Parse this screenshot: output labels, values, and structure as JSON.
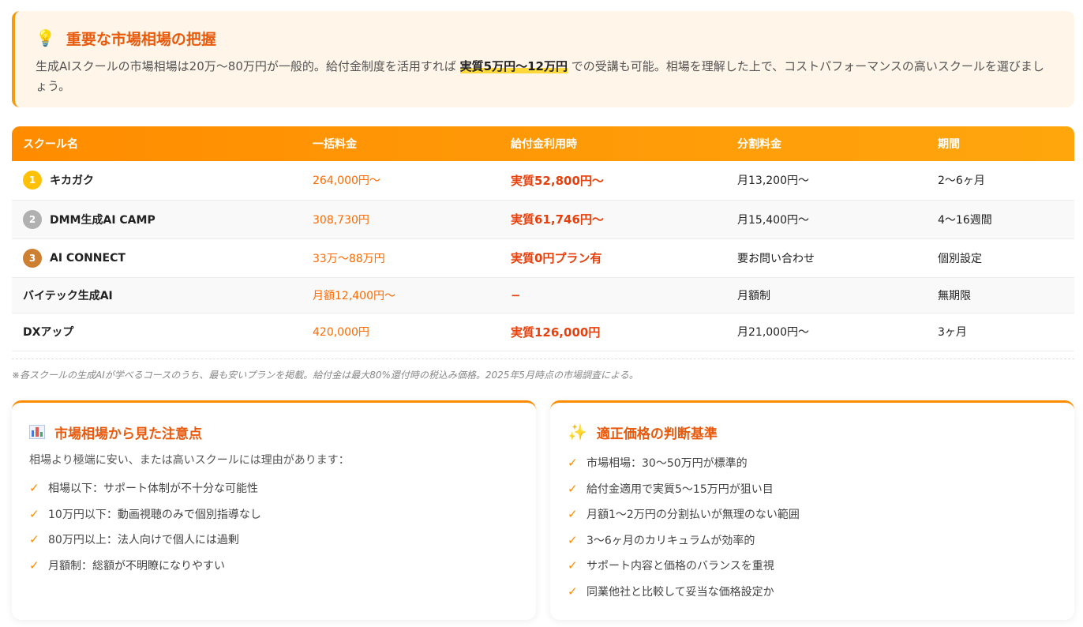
{
  "alert": {
    "icon": "lightbulb-icon",
    "title": "重要な市場相場の把握",
    "text_before": "生成AIスクールの市場相場は20万〜80万円が一般的。給付金制度を活用すれば ",
    "highlight": "実質5万円〜12万円",
    "text_after": " での受講も可能。相場を理解した上で、コストパフォーマンスの高いスクールを選びましょう。"
  },
  "table": {
    "headers": [
      "スクール名",
      "一括料金",
      "給付金利用時",
      "分割料金",
      "期間"
    ],
    "rows": [
      {
        "rank": "1",
        "rank_color": "#ffc107",
        "name": "キカガク",
        "price": "264,000円〜",
        "subsidy": "実質52,800円〜",
        "installment": "月13,200円〜",
        "period": "2〜6ヶ月"
      },
      {
        "rank": "2",
        "rank_color": "#b0b0b0",
        "name": "DMM生成AI CAMP",
        "price": "308,730円",
        "subsidy": "実質61,746円〜",
        "installment": "月15,400円〜",
        "period": "4〜16週間"
      },
      {
        "rank": "3",
        "rank_color": "#cd7f32",
        "name": "AI CONNECT",
        "price": "33万〜88万円",
        "subsidy": "実質0円プラン有",
        "installment": "要お問い合わせ",
        "period": "個別設定"
      },
      {
        "rank": "",
        "rank_color": "",
        "name": "バイテック生成AI",
        "price": "月額12,400円〜",
        "subsidy": "−",
        "installment": "月額制",
        "period": "無期限"
      },
      {
        "rank": "",
        "rank_color": "",
        "name": "DXアップ",
        "price": "420,000円",
        "subsidy": "実質126,000円",
        "installment": "月21,000円〜",
        "period": "3ヶ月"
      }
    ],
    "note": "※各スクールの生成AIが学べるコースのうち、最も安いプランを掲載。給付金は最大80%還付時の税込み価格。2025年5月時点の市場調査による。"
  },
  "card_left": {
    "icon": "bar-chart-icon",
    "title": "市場相場から見た注意点",
    "intro": "相場より極端に安い、または高いスクールには理由があります：",
    "items": [
      "相場以下：サポート体制が不十分な可能性",
      "10万円以下：動画視聴のみで個別指導なし",
      "80万円以上：法人向けで個人には過剰",
      "月額制：総額が不明瞭になりやすい"
    ]
  },
  "card_right": {
    "icon": "sparkles-icon",
    "title": "適正価格の判断基準",
    "items": [
      "市場相場：30〜50万円が標準的",
      "給付金適用で実質5〜15万円が狙い目",
      "月額1〜2万円の分割払いが無理のない範囲",
      "3〜6ヶ月のカリキュラムが効率的",
      "サポート内容と価格のバランスを重視",
      "同業他社と比較して妥当な価格設定か"
    ]
  },
  "check_glyph": "✓",
  "colors": {
    "accent": "#ff8c00",
    "title": "#e8590c",
    "price": "#ff6a00",
    "subsidy": "#e8400c"
  }
}
